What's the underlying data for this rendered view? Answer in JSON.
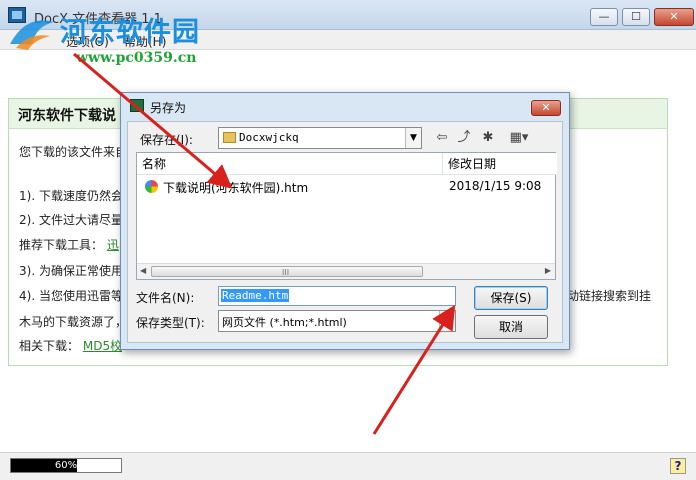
{
  "window": {
    "title": "DocX 文件查看器 1.1",
    "minimize": "—",
    "maximize": "☐",
    "close": "✕"
  },
  "menu": [
    "选项(O)",
    "帮助(H)"
  ],
  "watermark": {
    "brand": "河东软件园",
    "url": "www.pc0359.cn"
  },
  "content": {
    "title": "河东软件下载说",
    "lines": [
      "您下载的该文件来自",
      "1). 下载速度仍然会",
      "2). 文件过大请尽量",
      "推荐下载工具：",
      "3). 为确保正常使用",
      "4). 当您使用迅雷等",
      "木马的下载资源了，",
      "相关下载："
    ],
    "links": {
      "tool": "迅",
      "related": "MD5校"
    },
    "right_fragment": "动链接搜索到挂"
  },
  "status": {
    "progress_percent": 60,
    "progress_label": "60%",
    "help_icon": "?"
  },
  "dialog": {
    "title": "另存为",
    "save_in_label": "保存在(I):",
    "save_in_value": "Docxwjckq",
    "columns": [
      "名称",
      "修改日期"
    ],
    "files": [
      {
        "name": "下载说明(河东软件园).htm",
        "modified": "2018/1/15 9:08"
      }
    ],
    "filename_label": "文件名(N):",
    "filename_value": "Readme.htm",
    "filetype_label": "保存类型(T):",
    "filetype_value": "网页文件 (*.htm;*.html)",
    "save_button": "保存(S)",
    "cancel_button": "取消",
    "scroll_grip": "III"
  },
  "colors": {
    "annotation_arrow": "#d8201c",
    "content_header": "#e8f5e4",
    "selection": "#3399ff"
  }
}
